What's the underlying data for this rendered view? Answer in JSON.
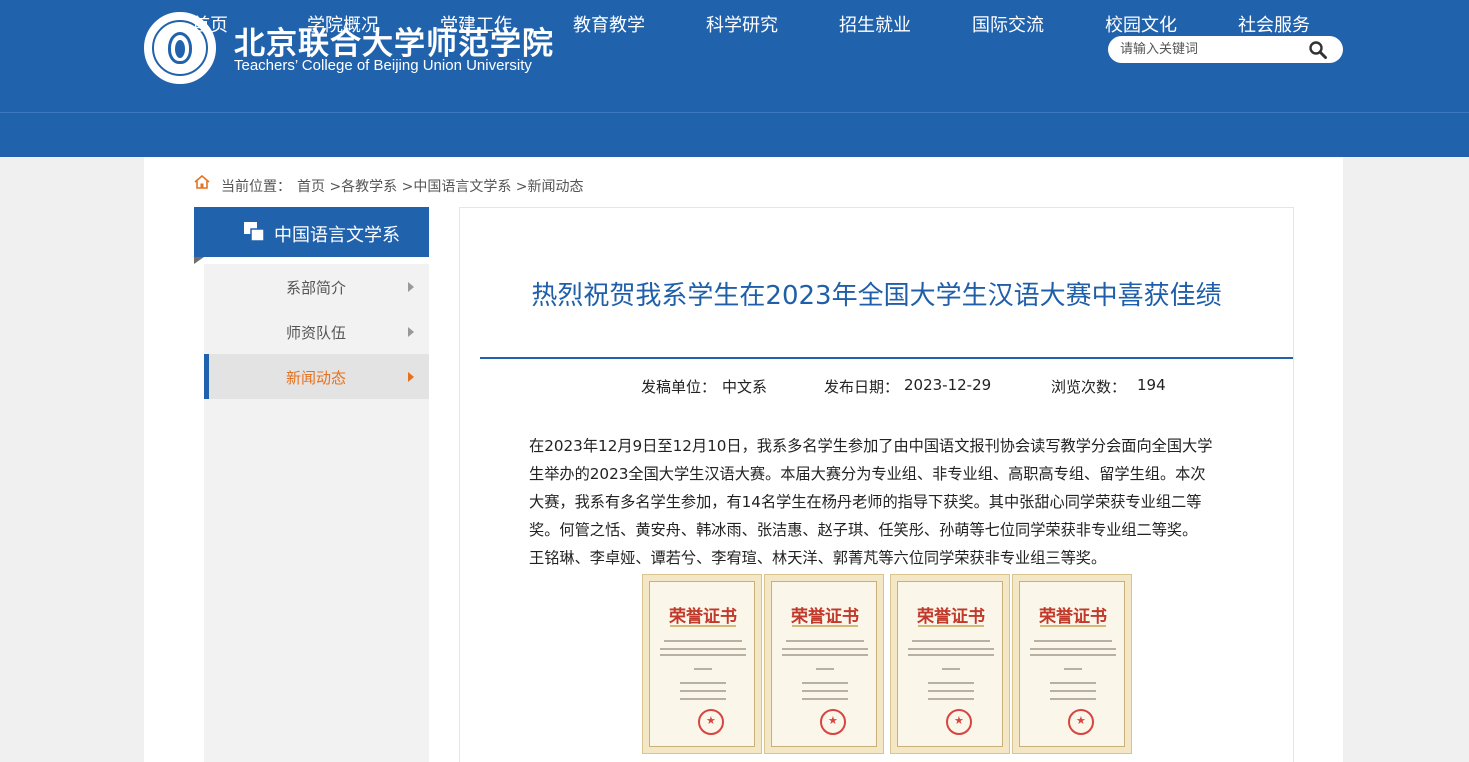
{
  "header": {
    "title_cn": "北京联合大学师范学院",
    "title_en": "Teachers’ College of Beijing Union University",
    "search_placeholder": "请输入关键词"
  },
  "nav": {
    "items": [
      "首页",
      "学院概况",
      "党建工作",
      "教育教学",
      "科学研究",
      "招生就业",
      "国际交流",
      "校园文化",
      "社会服务"
    ]
  },
  "breadcrumb": {
    "label": "当前位置：",
    "path": "首页 >各教学系 >中国语言文学系 >新闻动态"
  },
  "sidebar": {
    "title": "中国语言文学系",
    "items": [
      {
        "label": "系部简介",
        "active": false
      },
      {
        "label": "师资队伍",
        "active": false
      },
      {
        "label": "新闻动态",
        "active": true
      }
    ]
  },
  "article": {
    "title": "热烈祝贺我系学生在2023年全国大学生汉语大赛中喜获佳绩",
    "meta": {
      "unit_label": "发稿单位：",
      "unit": "中文系",
      "date_label": "发布日期：",
      "date": "2023-12-29",
      "views_label": "浏览次数：",
      "views": "194"
    },
    "lines": [
      "在2023年12月9日至12月10日，我系多名学生参加了由中国语文报刊协会读写教学分会面向全国大学",
      "生举办的2023全国大学生汉语大赛。本届大赛分为专业组、非专业组、高职高专组、留学生组。本次",
      "大赛，我系有多名学生参加，有14名学生在杨丹老师的指导下获奖。其中张甜心同学荣获专业组二等",
      "奖。何管之恬、黄安舟、韩冰雨、张洁惠、赵子琪、任笑彤、孙萌等七位同学荣获非专业组二等奖。",
      "王铭琳、李卓娅、谭若兮、李宥瑄、林天洋、郭菁芃等六位同学荣获非专业组三等奖。"
    ],
    "certificate_heading": "荣誉证书"
  },
  "colors": {
    "brand_blue": "#2162ad",
    "active_orange": "#e6711f",
    "title_blue": "#1f5fa9"
  }
}
